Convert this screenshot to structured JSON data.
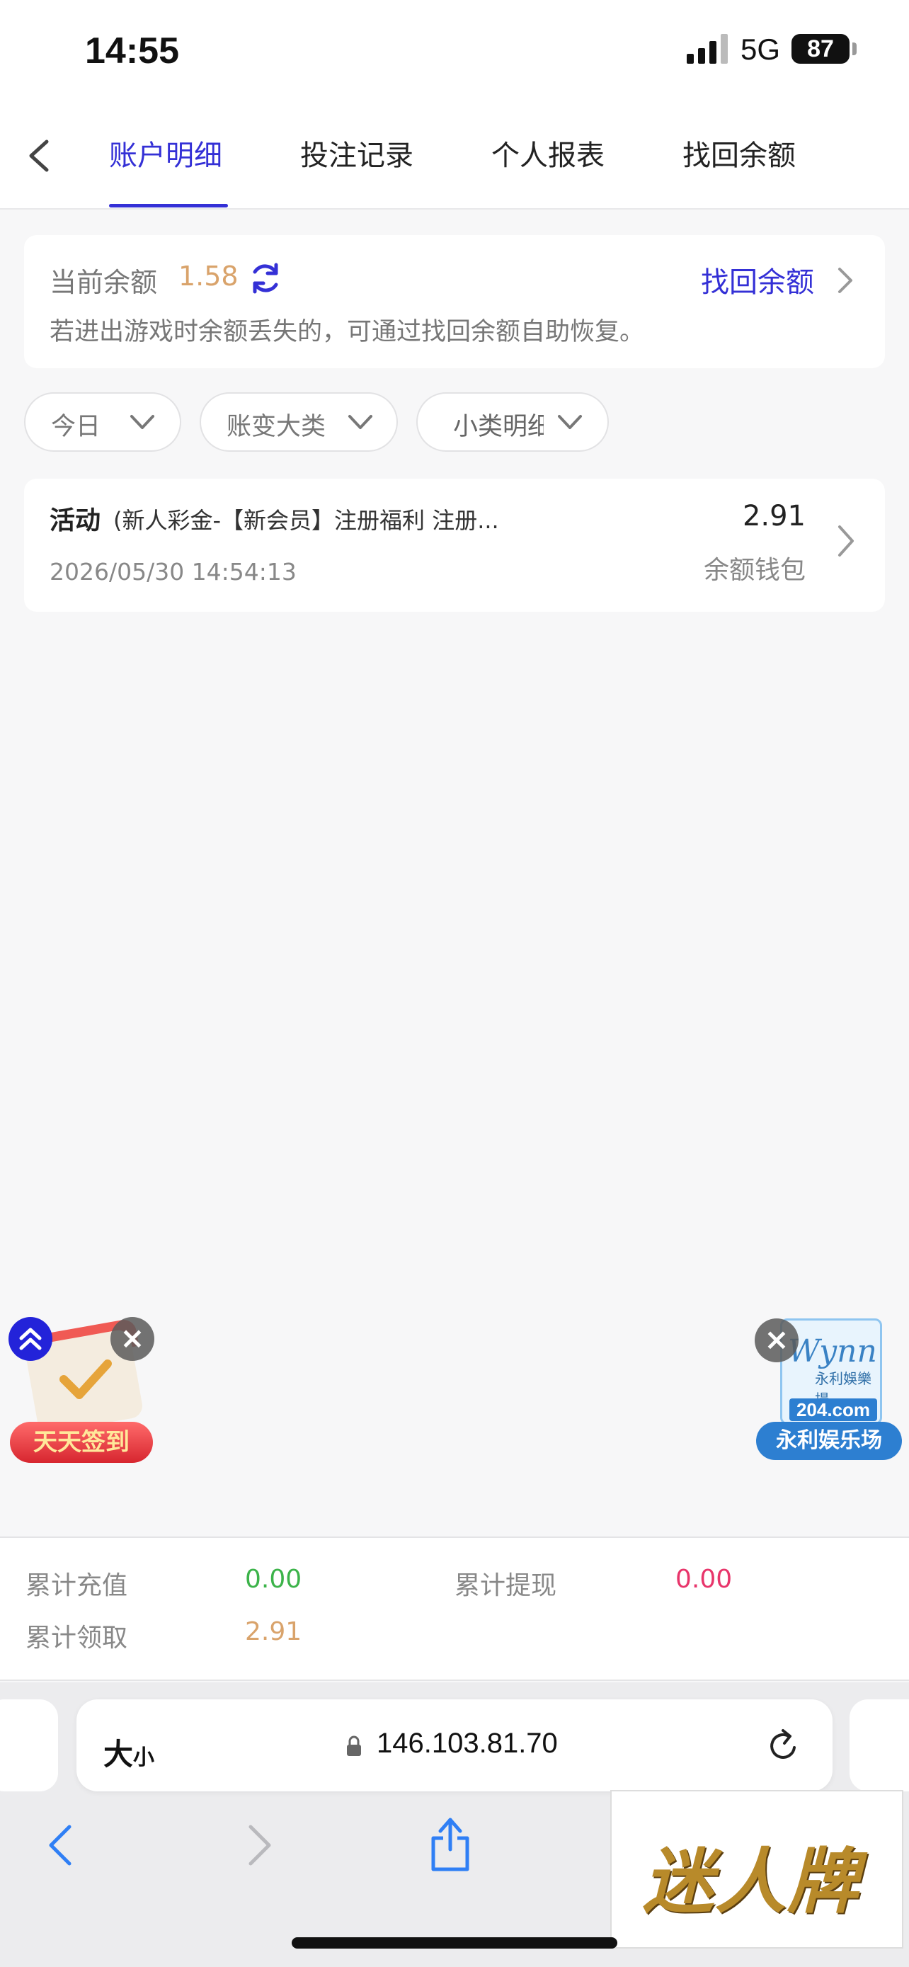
{
  "status_bar": {
    "time": "14:55",
    "network": "5G",
    "battery": "87"
  },
  "tabs": [
    {
      "label": "账户明细",
      "active": true
    },
    {
      "label": "投注记录",
      "active": false
    },
    {
      "label": "个人报表",
      "active": false
    },
    {
      "label": "找回余额",
      "active": false
    }
  ],
  "balance_card": {
    "label": "当前余额",
    "value": "1.58",
    "recover_link": "找回余额",
    "hint": "若进出游戏时余额丢失的，可通过找回余额自助恢复。"
  },
  "filters": [
    {
      "label": "今日"
    },
    {
      "label": "账变大类"
    },
    {
      "label": "小类明细"
    }
  ],
  "records": [
    {
      "type": "活动",
      "description": "(新人彩金-【新会员】注册福利 注册...",
      "date": "2026/05/30 14:54:13",
      "amount": "2.91",
      "wallet": "余额钱包"
    }
  ],
  "promos": {
    "checkin_label": "天天签到",
    "brand_label": "永利娱乐场",
    "brand_script": "Wynn",
    "brand_small": "永利娛樂場",
    "brand_domain": "204.com"
  },
  "totals": {
    "recharge_label": "累计充值",
    "recharge_value": "0.00",
    "withdraw_label": "累计提现",
    "withdraw_value": "0.00",
    "claimed_label": "累计领取",
    "claimed_value": "2.91"
  },
  "browser": {
    "text_size_big": "大",
    "text_size_small": "小",
    "url": "146.103.81.70"
  },
  "watermark": "迷人牌",
  "colors": {
    "accent": "#3430d6",
    "balance": "#d9a36b",
    "recharge": "#3cb34a",
    "withdraw": "#e8356b",
    "claimed": "#d9a36b"
  }
}
